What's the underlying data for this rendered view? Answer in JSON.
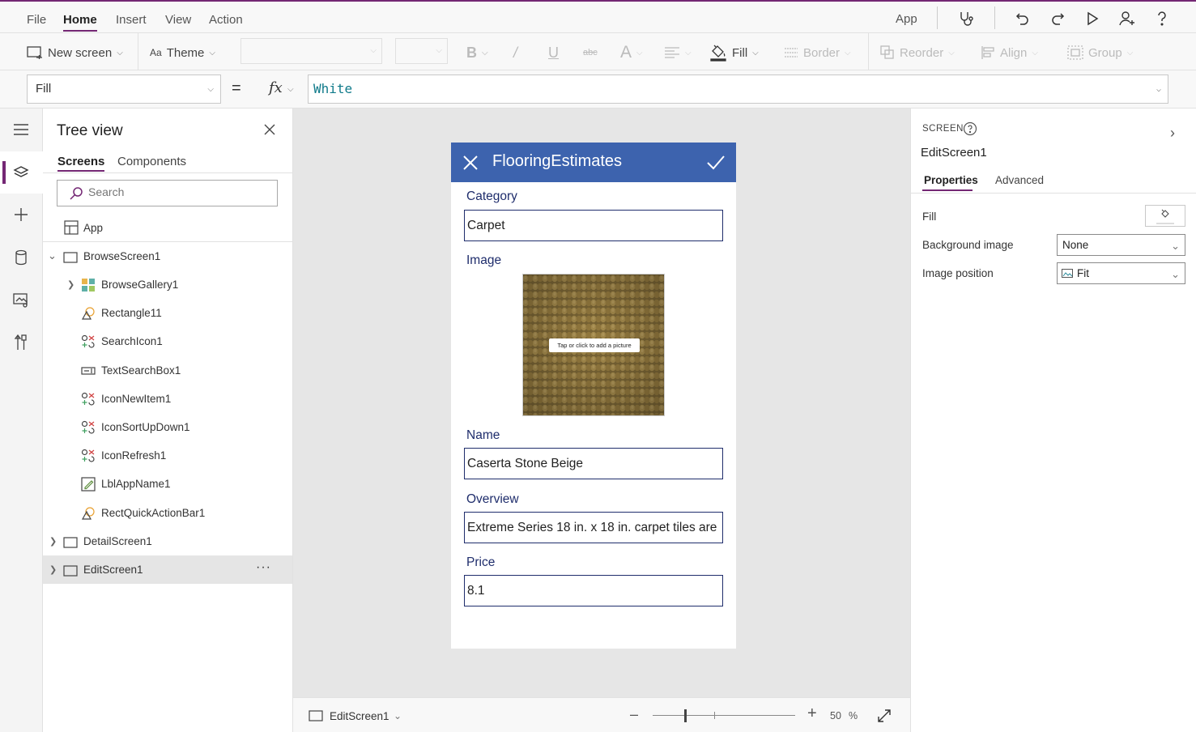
{
  "topbar": {
    "menu": [
      "File",
      "Home",
      "Insert",
      "View",
      "Action"
    ],
    "active_menu": "Home",
    "app_label": "App",
    "icons": [
      "stethoscope-icon",
      "undo-icon",
      "redo-icon",
      "play-icon",
      "share-user-icon",
      "help-icon"
    ]
  },
  "ribbon": {
    "new_screen": "New screen",
    "theme": "Theme",
    "bold": "B",
    "italic": "/",
    "underline": "U",
    "strike": "abc",
    "font_size_glyph": "A",
    "fill": "Fill",
    "border": "Border",
    "reorder": "Reorder",
    "align": "Align",
    "group": "Group"
  },
  "formula": {
    "property": "Fill",
    "equals": "=",
    "fx": "fx",
    "value": "White"
  },
  "tree": {
    "title": "Tree view",
    "tabs": [
      "Screens",
      "Components"
    ],
    "active_tab": "Screens",
    "search_placeholder": "Search",
    "app_item": "App",
    "items": [
      {
        "label": "BrowseScreen1",
        "level": 0,
        "expanded": true,
        "icon": "screen-icon"
      },
      {
        "label": "BrowseGallery1",
        "level": 1,
        "expandable": true,
        "icon": "gallery-icon"
      },
      {
        "label": "Rectangle11",
        "level": 1,
        "icon": "shape-icon"
      },
      {
        "label": "SearchIcon1",
        "level": 1,
        "icon": "icons-control-icon"
      },
      {
        "label": "TextSearchBox1",
        "level": 1,
        "icon": "text-input-icon"
      },
      {
        "label": "IconNewItem1",
        "level": 1,
        "icon": "icons-control-icon"
      },
      {
        "label": "IconSortUpDown1",
        "level": 1,
        "icon": "icons-control-icon"
      },
      {
        "label": "IconRefresh1",
        "level": 1,
        "icon": "icons-control-icon"
      },
      {
        "label": "LblAppName1",
        "level": 1,
        "icon": "label-icon"
      },
      {
        "label": "RectQuickActionBar1",
        "level": 1,
        "icon": "shape-icon"
      },
      {
        "label": "DetailScreen1",
        "level": 0,
        "expandable": true,
        "icon": "screen-icon"
      },
      {
        "label": "EditScreen1",
        "level": 0,
        "expandable": true,
        "icon": "screen-icon",
        "selected": true
      }
    ],
    "more": "···"
  },
  "app": {
    "title": "FlooringEstimates",
    "fields": [
      {
        "label": "Category",
        "value": "Carpet"
      },
      {
        "label": "Image"
      },
      {
        "label": "Name",
        "value": "Caserta Stone Beige"
      },
      {
        "label": "Overview",
        "value": "Extreme Series 18 in. x 18 in. carpet tiles are"
      },
      {
        "label": "Price",
        "value": "8.1"
      }
    ],
    "image_hint": "Tap or click to add a picture"
  },
  "status": {
    "screen": "EditScreen1",
    "zoom_value": "50",
    "zoom_unit": "%",
    "zoom_level": 0.22
  },
  "panel": {
    "section": "SCREEN",
    "name": "EditScreen1",
    "tabs": [
      "Properties",
      "Advanced"
    ],
    "active_tab": "Properties",
    "props": [
      {
        "label": "Fill"
      },
      {
        "label": "Background image",
        "value": "None"
      },
      {
        "label": "Image position",
        "value": "Fit"
      }
    ]
  },
  "colors": {
    "accent": "#742774",
    "app_header": "#3d63ae",
    "field_text": "#1f2d6c",
    "formula_text": "#0f7a8a"
  }
}
